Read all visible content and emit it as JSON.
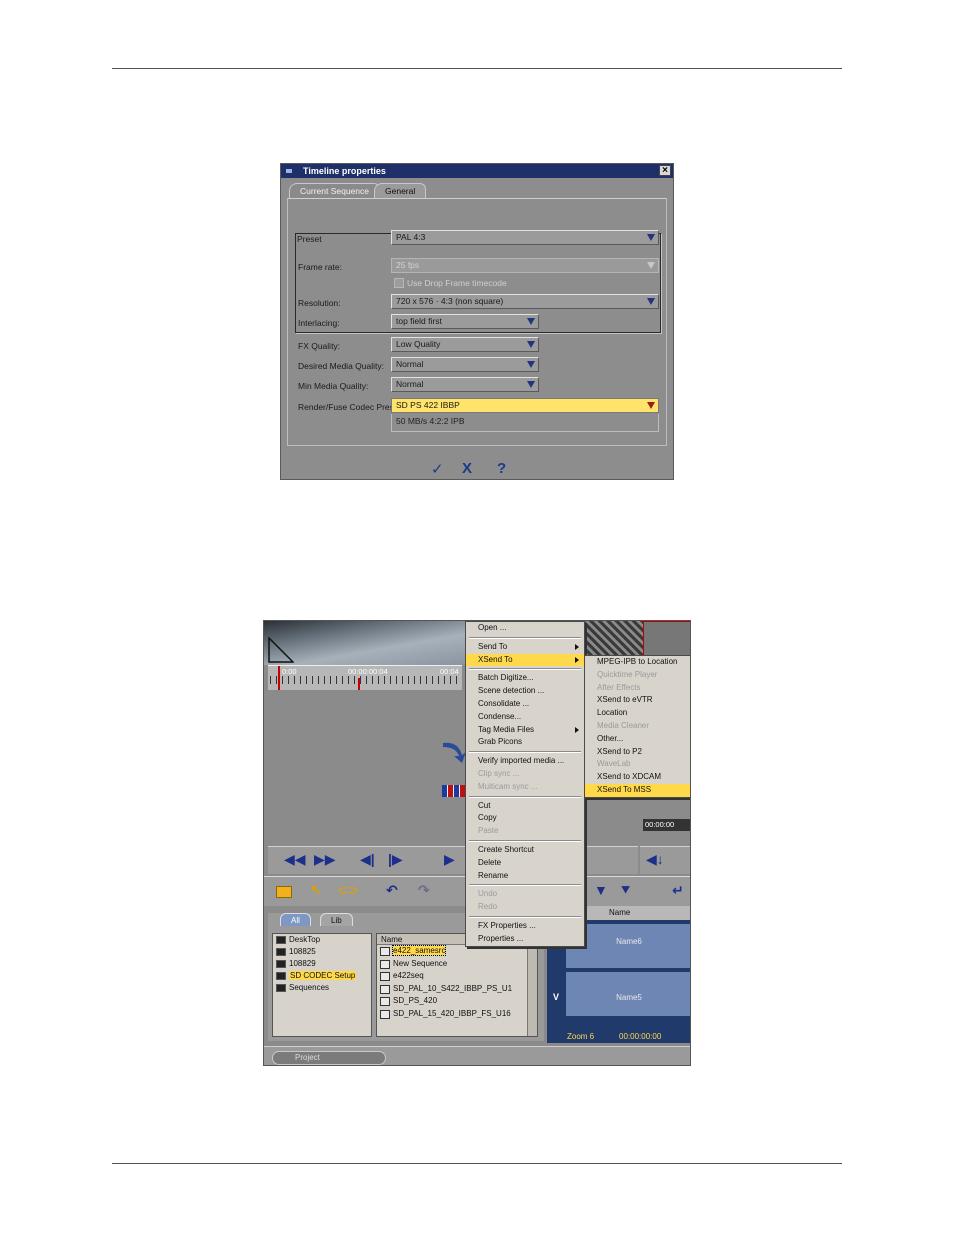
{
  "dialog": {
    "title": "Timeline properties",
    "tabs": [
      "Current Sequence",
      "General"
    ],
    "labels": {
      "preset": "Preset",
      "frame_rate": "Frame rate:",
      "resolution": "Resolution:",
      "interlacing": "Interlacing:",
      "fx_quality": "FX Quality:",
      "desired_media_quality": "Desired Media Quality:",
      "min_media_quality": "Min Media Quality:",
      "render_codec": "Render/Fuse Codec Pres."
    },
    "values": {
      "preset": "PAL   4:3",
      "frame_rate": "25 fps",
      "drop_frame": "Use Drop Frame timecode",
      "resolution": "720 x 576 · 4:3 (non square)",
      "interlacing": "top field first",
      "fx_quality": "Low Quality",
      "desired_media_quality": "Normal",
      "min_media_quality": "Normal",
      "render_codec": "SD PS 422 IBBP",
      "render_codec_desc": "50 MB/s 4:2:2 IPB"
    },
    "buttons": {
      "ok": "✓",
      "cancel": "X",
      "help": "?"
    }
  },
  "app": {
    "timecodes": [
      "0:00",
      "00:00:00:04",
      "00:04"
    ],
    "context_menu": [
      {
        "label": "Open ...",
        "state": "normal"
      },
      {
        "sep": true
      },
      {
        "label": "Send To",
        "state": "normal",
        "submenu": true
      },
      {
        "label": "XSend To",
        "state": "highlight",
        "submenu": true
      },
      {
        "sep": true
      },
      {
        "label": "Batch Digitize...",
        "state": "normal"
      },
      {
        "label": "Scene detection ...",
        "state": "normal"
      },
      {
        "label": "Consolidate ...",
        "state": "normal"
      },
      {
        "label": "Condense...",
        "state": "normal"
      },
      {
        "label": "Tag Media Files",
        "state": "normal",
        "submenu": true
      },
      {
        "label": "Grab Picons",
        "state": "normal"
      },
      {
        "sep": true
      },
      {
        "label": "Verify imported media ...",
        "state": "normal"
      },
      {
        "label": "Clip sync ...",
        "state": "disabled"
      },
      {
        "label": "Multicam sync ...",
        "state": "disabled"
      },
      {
        "sep": true
      },
      {
        "label": "Cut",
        "state": "normal"
      },
      {
        "label": "Copy",
        "state": "normal"
      },
      {
        "label": "Paste",
        "state": "disabled"
      },
      {
        "sep": true
      },
      {
        "label": "Create Shortcut",
        "state": "normal"
      },
      {
        "label": "Delete",
        "state": "normal"
      },
      {
        "label": "Rename",
        "state": "normal"
      },
      {
        "sep": true
      },
      {
        "label": "Undo",
        "state": "disabled"
      },
      {
        "label": "Redo",
        "state": "disabled"
      },
      {
        "sep": true
      },
      {
        "label": "FX Properties ...",
        "state": "normal"
      },
      {
        "label": "Properties ...",
        "state": "normal"
      }
    ],
    "submenu": [
      {
        "label": "MPEG-IPB to Location",
        "state": "normal"
      },
      {
        "label": "Quicktime Player",
        "state": "disabled"
      },
      {
        "label": "After Effects",
        "state": "disabled"
      },
      {
        "label": "XSend to eVTR",
        "state": "normal"
      },
      {
        "label": "Location",
        "state": "normal"
      },
      {
        "label": "Media Cleaner",
        "state": "disabled"
      },
      {
        "label": "Other...",
        "state": "normal"
      },
      {
        "label": "XSend to P2",
        "state": "normal"
      },
      {
        "label": "WaveLab",
        "state": "disabled"
      },
      {
        "label": "XSend to XDCAM",
        "state": "normal"
      },
      {
        "label": "XSend To MSS",
        "state": "highlight"
      }
    ],
    "browser_tabs": [
      "All",
      "Lib"
    ],
    "tree": [
      {
        "label": "DeskTop",
        "selected": false
      },
      {
        "label": "108825",
        "selected": false
      },
      {
        "label": "108829",
        "selected": false
      },
      {
        "label": "SD CODEC Setup",
        "selected": true
      },
      {
        "label": "Sequences",
        "selected": false
      }
    ],
    "files_header": "Name",
    "files": [
      {
        "label": "e422_samesrc",
        "selected": true
      },
      {
        "label": "New Sequence",
        "selected": false
      },
      {
        "label": "e422seq",
        "selected": false
      },
      {
        "label": "SD_PAL_10_S422_IBBP_PS_U1",
        "selected": false
      },
      {
        "label": "SD_PS_420",
        "selected": false
      },
      {
        "label": "SD_PAL_15_420_IBBP_FS_U16",
        "selected": false
      }
    ],
    "track_header": "Name",
    "tracks": [
      "Name6",
      "Name5"
    ],
    "track_letter": "V",
    "zoom": "Zoom 6",
    "zoom_tc": "00:00:00:00",
    "right_tc": "00:00:00",
    "project": "Project"
  }
}
